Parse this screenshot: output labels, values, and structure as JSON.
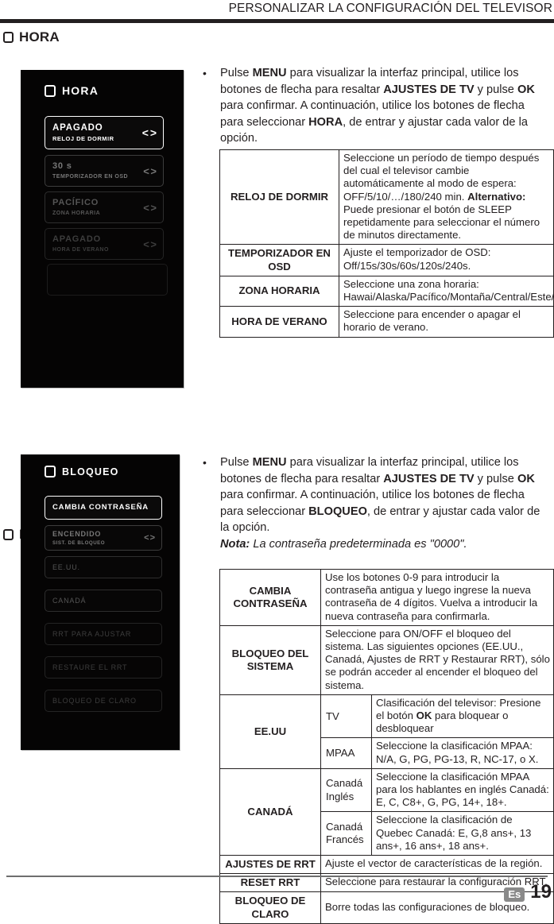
{
  "running_head": "PERSONALIZAR LA CONFIGURACIÓN DEL TELEVISOR",
  "sections": {
    "hora": {
      "heading": "HORA",
      "osd": {
        "title": "HORA",
        "rows": [
          {
            "value": "APAGADO",
            "label": "RELOJ DE DORMIR",
            "arrows": "< >"
          },
          {
            "value": "30 s",
            "label": "TEMPORIZADOR EN OSD",
            "arrows": "< >"
          },
          {
            "value": "PACÍFICO",
            "label": "ZONA HORARIA",
            "arrows": "< >"
          },
          {
            "value": "APAGADO",
            "label": "HORA DE VERANO",
            "arrows": "< >"
          },
          {
            "value": "",
            "label": "",
            "arrows": ""
          }
        ]
      },
      "paragraph": {
        "bullet": "•",
        "p1": "Pulse ",
        "b1": "MENU",
        "p2": " para visualizar la interfaz principal, utilice los botones de flecha para resaltar  ",
        "b2": "AJUSTES DE TV",
        "p3": " y pulse ",
        "b3": "OK",
        "p4": " para confirmar. A continuación, utilice los botones de flecha para seleccionar ",
        "b4": "HORA",
        "p5": ", de entrar y ajustar cada valor de la opción."
      },
      "table": [
        {
          "key": "RELOJ DE DORMIR",
          "desc_plain_1": "Seleccione un período de tiempo después del cual el televisor cambie automáticamente al modo de espera: OFF/5/10/…/180/240 min. ",
          "desc_bold": "Alternativo:",
          "desc_plain_2": " Puede presionar el botón de SLEEP repetidamente para seleccionar el número de minutos directamente."
        },
        {
          "key": "TEMPORIZADOR EN OSD",
          "desc": "Ajuste el temporizador de OSD: Off/15s/30s/60s/120s/240s."
        },
        {
          "key": "ZONA HORARIA",
          "desc": "Seleccione una zona horaria: Hawai/Alaska/Pacífico/Montaña/Central/Este/Atlántico/Terranova."
        },
        {
          "key": "HORA DE VERANO",
          "desc": "Seleccione para encender o apagar el horario de verano."
        }
      ]
    },
    "bloqueo": {
      "heading": "BLOQUEO",
      "osd": {
        "title": "BLOQUEO",
        "rows": [
          {
            "value": "CAMBIA CONTRASEÑA",
            "label": "",
            "arrows": ""
          },
          {
            "value": "ENCENDIDO",
            "label": "SIST. DE BLOQUEO",
            "arrows": "< >"
          },
          {
            "value": "EE.UU.",
            "label": "",
            "arrows": ""
          },
          {
            "value": "CANADÁ",
            "label": "",
            "arrows": ""
          },
          {
            "value": "RRT PARA AJUSTAR",
            "label": "",
            "arrows": ""
          },
          {
            "value": "RESTAURE EL RRT",
            "label": "",
            "arrows": ""
          },
          {
            "value": "BLOQUEO DE CLARO",
            "label": "",
            "arrows": ""
          }
        ]
      },
      "paragraph": {
        "bullet": "•",
        "p1": "Pulse ",
        "b1": "MENU",
        "p2": " para visualizar la interfaz principal, utilice los botones de flecha para resaltar  ",
        "b2": "AJUSTES DE TV",
        "p3": " y pulse ",
        "b3": "OK",
        "p4": " para confirmar. A continuación, utilice los botones de flecha para seleccionar ",
        "b4": "BLOQUEO",
        "p5": ", de entrar y ajustar cada valor de la opción.",
        "note_label": "Nota:",
        "note_text": " La contraseña predeterminada es \"0000\"."
      },
      "table": {
        "cambia": {
          "key": "CAMBIA CONTRASEÑA",
          "desc": "Use los botones 0-9 para introducir la contraseña antigua y luego ingrese la nueva contraseña de 4 dígitos. Vuelva a introducir la nueva contraseña para confirmarla."
        },
        "sistema": {
          "key": "BLOQUEO DEL SISTEMA",
          "desc": "Seleccione para ON/OFF el bloqueo del sistema. Las siguientes opciones (EE.UU., Canadá, Ajustes de RRT y Restaurar RRT), sólo se podrán acceder al encender el bloqueo del sistema."
        },
        "eeuu": {
          "key": "EE.UU",
          "sub1": "TV",
          "sub1_desc_1": "Clasificación del televisor: Presione el botón ",
          "sub1_desc_bold": "OK",
          "sub1_desc_2": " para bloquear o desbloquear",
          "sub2": "MPAA",
          "sub2_desc": "Seleccione la clasificación MPAA: N/A, G, PG, PG-13, R, NC-17, o X."
        },
        "canada": {
          "key": "CANADÁ",
          "sub1": "Canadá Inglés",
          "sub1_desc": "Seleccione la clasificación MPAA para los hablantes en inglés Canadá: E, C, C8+, G, PG, 14+, 18+.",
          "sub2": "Canadá Francés",
          "sub2_desc": "Seleccione la clasificación de Quebec Canadá: E, G,8 ans+, 13 ans+, 16 ans+, 18 ans+."
        },
        "rrt": {
          "key": "AJUSTES DE RRT",
          "desc": "Ajuste el vector de características de la región."
        },
        "reset": {
          "key": "RESET RRT",
          "desc": "Seleccione para restaurar la configuración RRT."
        },
        "claro": {
          "key": "BLOQUEO DE CLARO",
          "desc": "Borre todas las configuraciones de bloqueo."
        }
      }
    }
  },
  "footer": {
    "lang_badge": "Es",
    "page_number": "19"
  }
}
